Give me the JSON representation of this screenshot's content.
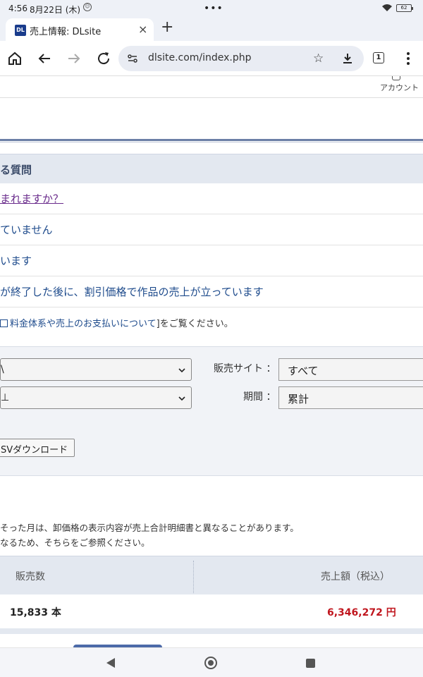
{
  "status_bar": {
    "time": "4:56",
    "date": "8月22日 (木)",
    "notification_badge": "☺",
    "center_dots": "•••",
    "battery_level": "62"
  },
  "tab": {
    "favicon_text": "DL",
    "title": "売上情報: DLsite",
    "close_glyph": "×",
    "new_tab_glyph": "+"
  },
  "toolbar": {
    "url": "dlsite.com/index.php",
    "tab_count": "1",
    "star_glyph": "☆"
  },
  "header": {
    "account_label": "アカウント"
  },
  "faq": {
    "heading": "る質問",
    "rows": [
      {
        "text": "まれますか？",
        "visited": true
      },
      {
        "text": "ていません",
        "visited": false
      },
      {
        "text": "います",
        "visited": false
      },
      {
        "text": "が終了した後に、割引価格で作品の売上が立っています",
        "visited": false
      }
    ],
    "note_link": "料金体系や売上のお支払いについて",
    "note_suffix": "]をご覧ください。"
  },
  "filters": {
    "select1_value": "\\",
    "select2_value": "⊥",
    "site_label": "販売サイト ：",
    "site_value": "すべて",
    "period_label": "期間 ：",
    "period_value": "累計",
    "csv_button": "SVダウンロード"
  },
  "notes": {
    "line1": "そった月は、卸価格の表示内容が売上合計明細書と異なることがあります。",
    "line2": "なるため、そちらをご参照ください。"
  },
  "sales_table": {
    "col_count": "販売数",
    "col_amount": "売上額（税込）",
    "count_value": "15,833 本",
    "amount_value": "6,346,272 円"
  },
  "colors": {
    "link": "#1e4b8c",
    "visited_link": "#6a2c8c",
    "amount_red": "#c0161e",
    "header_bg": "#e3e8f0"
  }
}
